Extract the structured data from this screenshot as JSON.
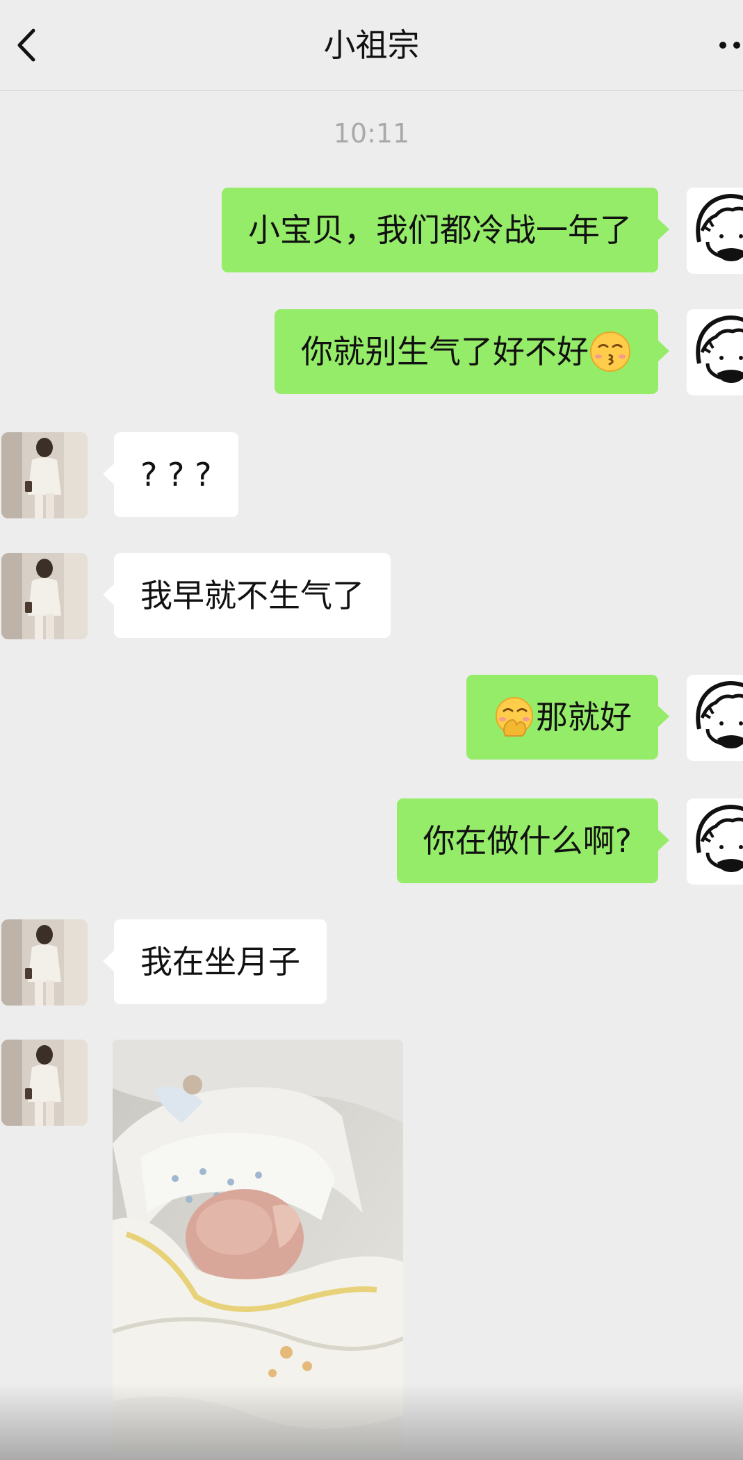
{
  "header": {
    "title": "小祖宗",
    "back_icon": "chevron-left-icon",
    "more_icon": "more-icon"
  },
  "timestamp": "10:11",
  "messages": [
    {
      "sender": "self",
      "text": "小宝贝，我们都冷战一年了"
    },
    {
      "sender": "self",
      "text": "你就别生气了好不好",
      "emoji": "kissing-face-icon"
    },
    {
      "sender": "other",
      "text": "? ? ?"
    },
    {
      "sender": "other",
      "text": "我早就不生气了"
    },
    {
      "sender": "self",
      "text": "那就好",
      "emoji": "hand-over-mouth-face-icon"
    },
    {
      "sender": "self",
      "text": "你在做什么啊?"
    },
    {
      "sender": "other",
      "text": "我在坐月子"
    },
    {
      "sender": "other",
      "type": "image",
      "image": "photo-newborn-baby"
    }
  ],
  "colors": {
    "self_bubble": "#95ec69",
    "other_bubble": "#ffffff",
    "background": "#ededed"
  }
}
